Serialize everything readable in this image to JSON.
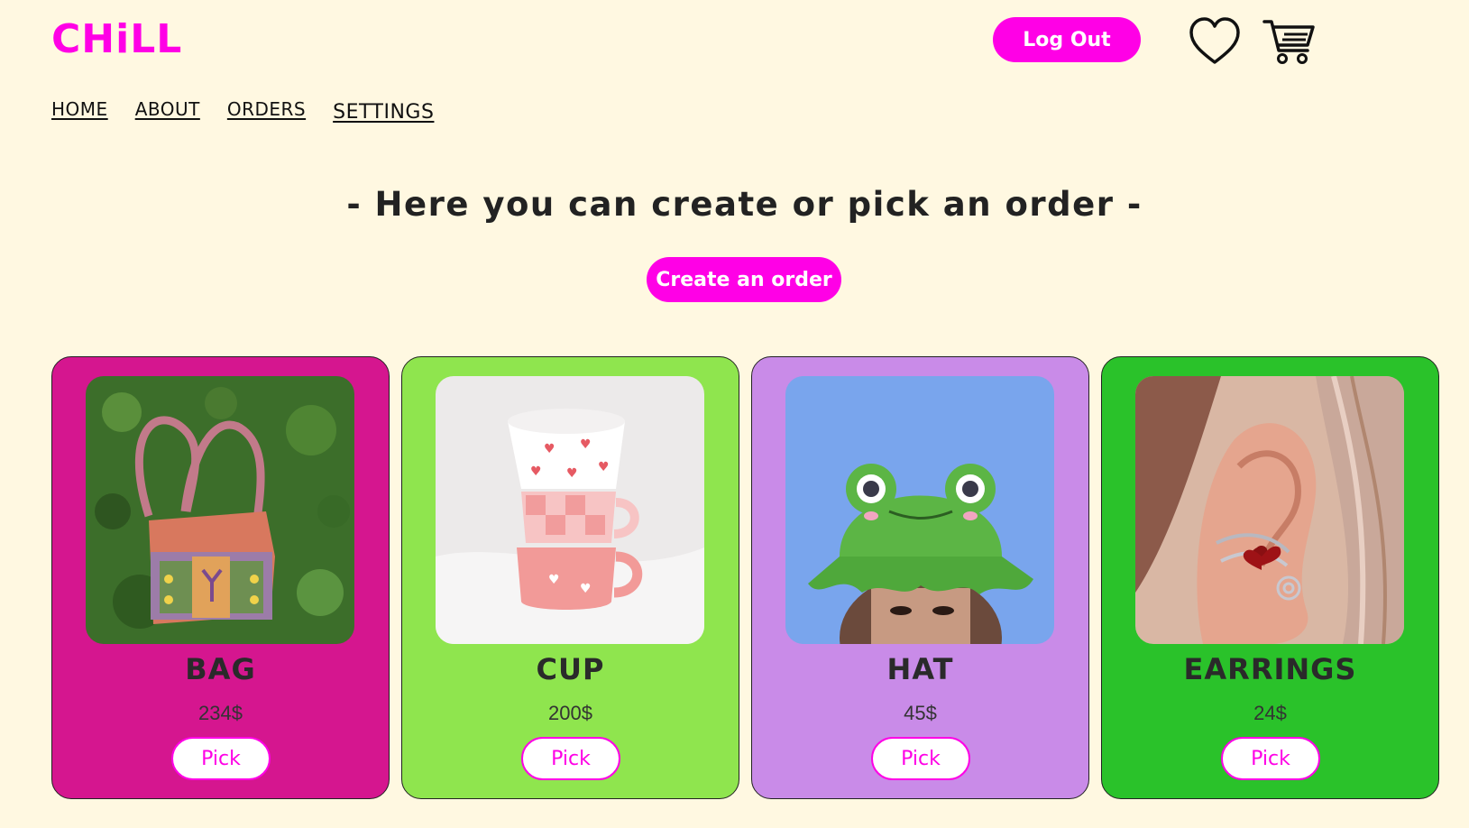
{
  "app": {
    "logo": "CHiLL"
  },
  "header": {
    "logout_label": "Log Out",
    "icons": [
      "heart-icon",
      "cart-icon"
    ]
  },
  "nav": {
    "items": [
      {
        "label": "HOME"
      },
      {
        "label": "ABOUT"
      },
      {
        "label": "ORDERS"
      },
      {
        "label": "SETTINGS"
      }
    ]
  },
  "main": {
    "headline": "- Here you can create or pick an order -",
    "create_label": "Create an order",
    "cards": [
      {
        "title": "BAG",
        "price": "234$",
        "pick_label": "Pick",
        "bg_color": "#d5168f"
      },
      {
        "title": "CUP",
        "price": "200$",
        "pick_label": "Pick",
        "bg_color": "#8fe54e"
      },
      {
        "title": "HAT",
        "price": "45$",
        "pick_label": "Pick",
        "bg_color": "#c98be8"
      },
      {
        "title": "EARRINGS",
        "price": "24$",
        "pick_label": "Pick",
        "bg_color": "#2ac22a"
      }
    ]
  },
  "colors": {
    "background": "#fff8e1",
    "accent": "#ff00e6"
  }
}
